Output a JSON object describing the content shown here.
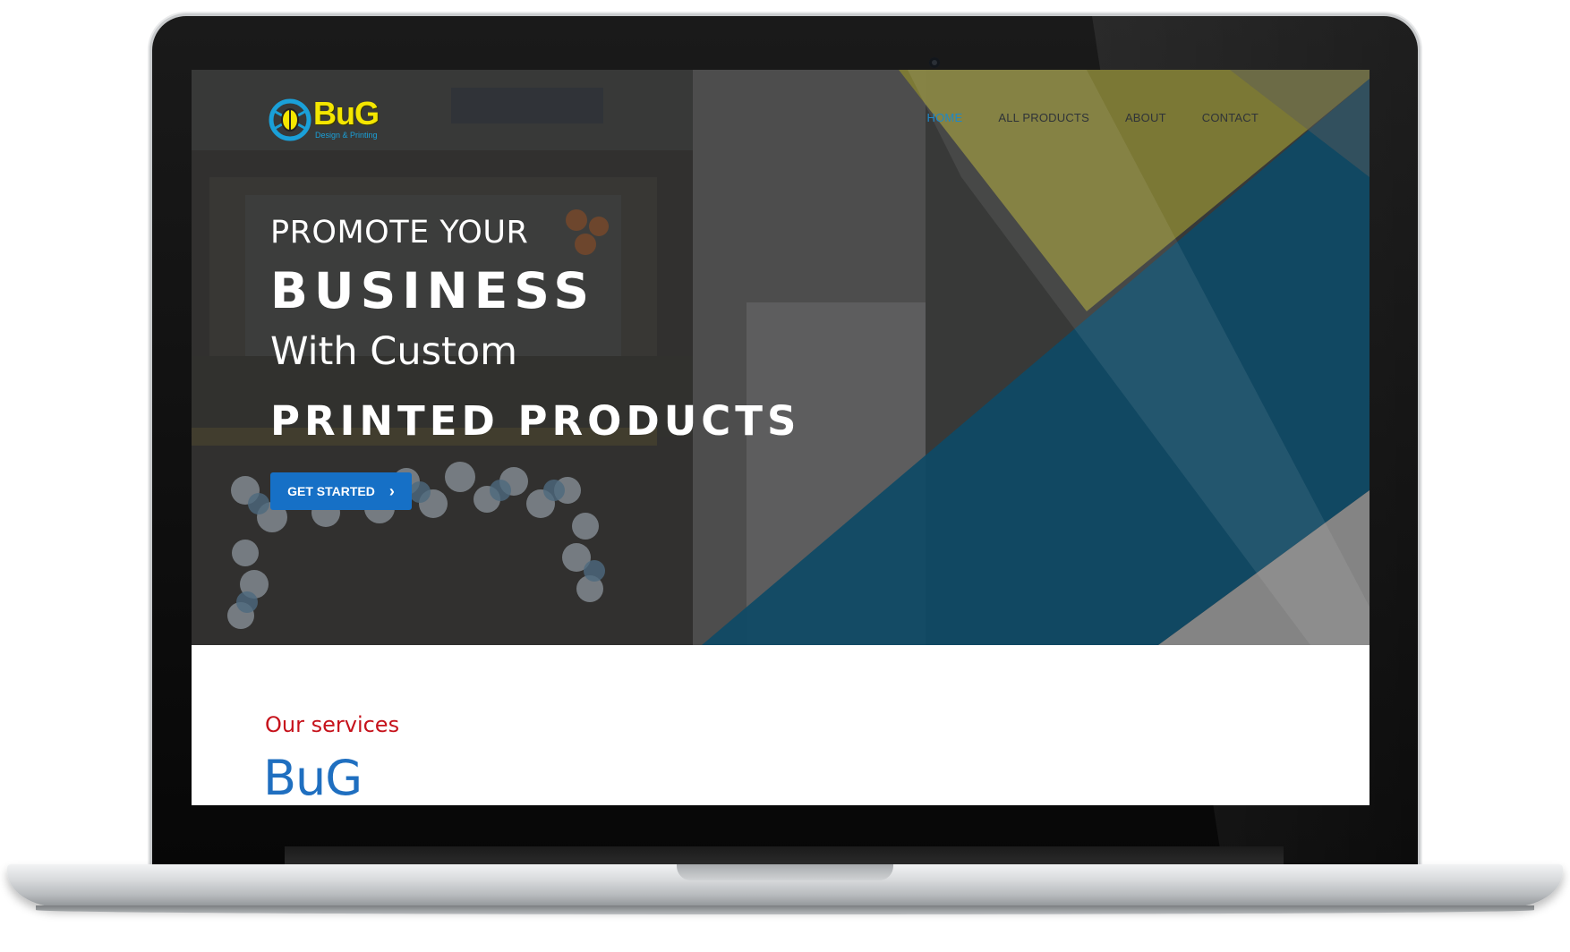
{
  "logo": {
    "word": "BuG",
    "tagline": "Design & Printing"
  },
  "nav": [
    {
      "label": "HOME",
      "active": true
    },
    {
      "label": "ALL PRODUCTS",
      "active": false
    },
    {
      "label": "ABOUT",
      "active": false
    },
    {
      "label": "CONTACT",
      "active": false
    }
  ],
  "hero": {
    "line1": "PROMOTE YOUR",
    "line2": "BUSINESS",
    "line3": "With Custom",
    "line4": "PRINTED PRODUCTS",
    "cta_label": "GET STARTED",
    "cta_icon": "chevron-right-icon"
  },
  "services": {
    "eyebrow": "Our services",
    "title": "BuG"
  },
  "colors": {
    "accent_blue": "#1670c6",
    "nav_active": "#1e88c8",
    "services_red": "#c6121b",
    "logo_yellow": "#f4e600",
    "shape_teal": "#0d4b67",
    "shape_olive": "#8c8b30"
  }
}
